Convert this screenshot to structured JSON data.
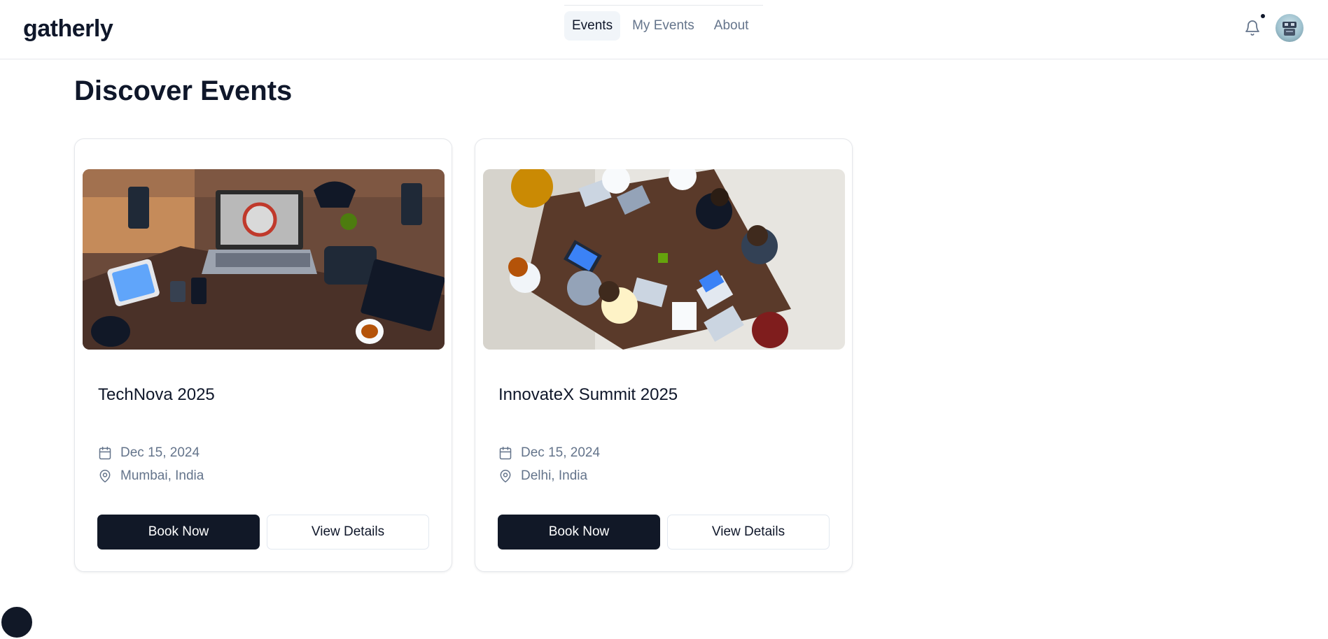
{
  "header": {
    "logo": "gatherly",
    "nav": [
      {
        "label": "Events",
        "active": true
      },
      {
        "label": "My Events",
        "active": false
      },
      {
        "label": "About",
        "active": false
      }
    ],
    "icons": {
      "notifications": "bell-icon",
      "profile": "avatar"
    }
  },
  "main": {
    "title": "Discover Events",
    "events": [
      {
        "title": "TechNova 2025",
        "date": "Dec 15, 2024",
        "location": "Mumbai, India",
        "book_label": "Book Now",
        "details_label": "View Details"
      },
      {
        "title": "InnovateX Summit 2025",
        "date": "Dec 15, 2024",
        "location": "Delhi, India",
        "book_label": "Book Now",
        "details_label": "View Details"
      }
    ]
  },
  "colors": {
    "primary": "#111827",
    "muted_text": "#64748b",
    "border": "#e5e7eb",
    "nav_active_bg": "#f1f5f9"
  }
}
